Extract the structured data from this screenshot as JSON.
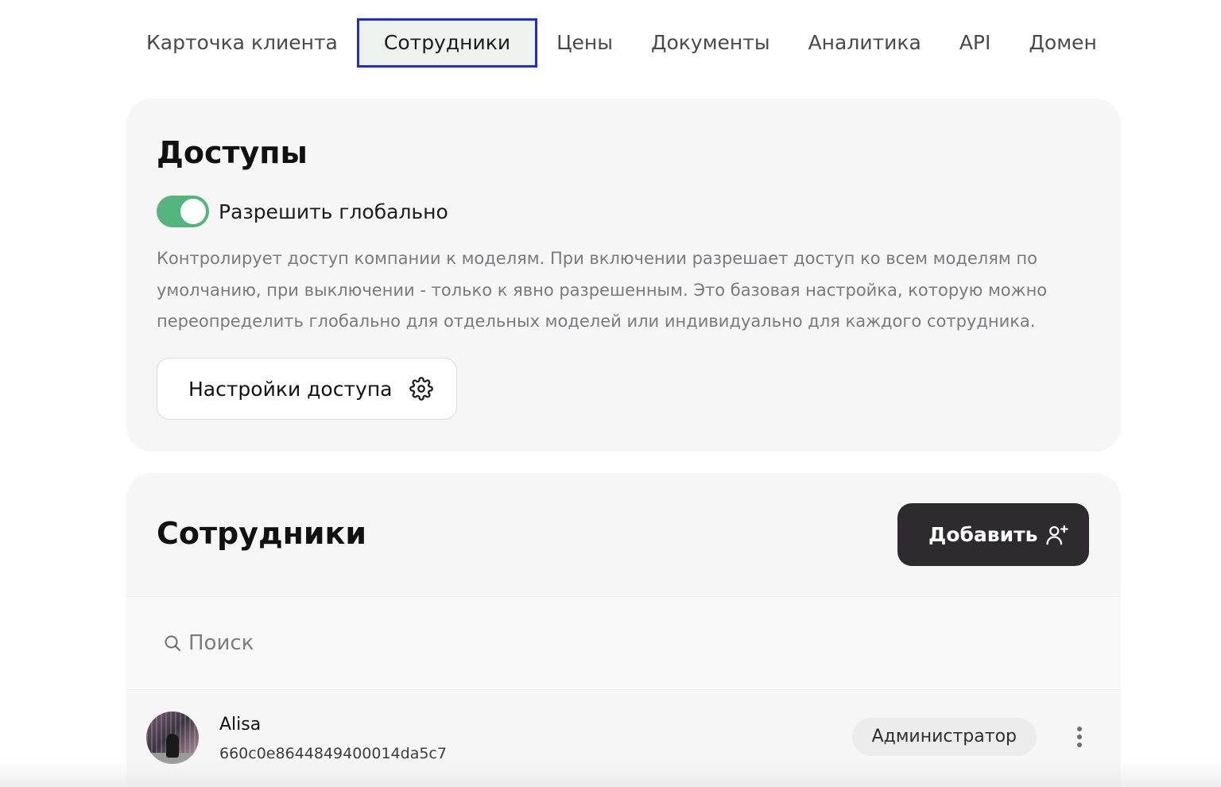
{
  "tabs": [
    {
      "label": "Карточка клиента"
    },
    {
      "label": "Сотрудники"
    },
    {
      "label": "Цены"
    },
    {
      "label": "Документы"
    },
    {
      "label": "Аналитика"
    },
    {
      "label": "API"
    },
    {
      "label": "Домен"
    }
  ],
  "active_tab": "Сотрудники",
  "access": {
    "title": "Доступы",
    "toggle_label": "Разрешить глобально",
    "toggle_on": true,
    "description": "Контролирует доступ компании к моделям. При включении разрешает доступ ко всем моделям по умолчанию, при выключении - только к явно разрешенным. Это базовая настройка, которую можно переопределить глобально для отдельных моделей или индивидуально для каждого сотрудника.",
    "settings_button": "Настройки доступа",
    "settings_icon": "gear-icon"
  },
  "employees": {
    "title": "Сотрудники",
    "add_button": "Добавить",
    "add_icon": "user-plus-icon",
    "search": {
      "placeholder": "Поиск",
      "value": "",
      "icon": "search-icon"
    },
    "list": [
      {
        "name": "Alisa",
        "id": "660c0e8644849400014da5c7",
        "role": "Администратор"
      }
    ]
  },
  "colors": {
    "toggle_on": "#53b47d",
    "active_tab_border": "#1f2cd6",
    "primary_button": "#2e2b2e",
    "card_bg": "#f6f6f6"
  }
}
